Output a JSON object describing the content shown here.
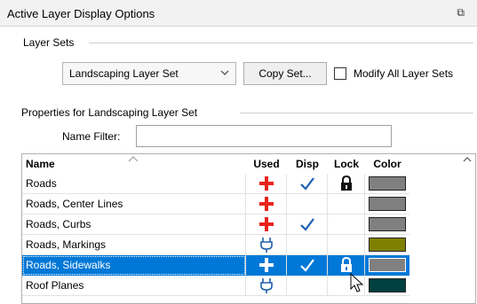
{
  "window": {
    "title": "Active Layer Display Options",
    "float_glyph": "⧉"
  },
  "layer_sets": {
    "group_label": "Layer Sets",
    "selected_set": "Landscaping Layer Set",
    "copy_button": "Copy Set...",
    "modify_all_label": "Modify All Layer Sets",
    "modify_all_checked": false
  },
  "properties": {
    "group_label": "Properties for Landscaping Layer Set",
    "name_filter_label": "Name Filter:",
    "name_filter_value": ""
  },
  "grid": {
    "columns": {
      "name": "Name",
      "used": "Used",
      "disp": "Disp",
      "lock": "Lock",
      "color": "Color"
    },
    "rows": [
      {
        "name": "Roads",
        "used": "cross",
        "disp": true,
        "lock": true,
        "color": "#808080",
        "selected": false
      },
      {
        "name": "Roads, Center Lines",
        "used": "cross",
        "disp": false,
        "lock": false,
        "color": "#808080",
        "selected": false
      },
      {
        "name": "Roads, Curbs",
        "used": "cross",
        "disp": true,
        "lock": false,
        "color": "#808080",
        "selected": false
      },
      {
        "name": "Roads, Markings",
        "used": "plug",
        "disp": false,
        "lock": false,
        "color": "#808000",
        "selected": false
      },
      {
        "name": "Roads, Sidewalks",
        "used": "cross",
        "disp": true,
        "lock": true,
        "color": "#808080",
        "selected": true
      },
      {
        "name": "Roof Planes",
        "used": "plug",
        "disp": false,
        "lock": false,
        "color": "#004040",
        "selected": false
      }
    ]
  },
  "colors": {
    "accent": "#0078d7",
    "used_red": "#e8231c",
    "check_blue": "#1a5fb4",
    "plug_blue": "#1f5fa8"
  },
  "icons": {
    "used": "plus-cross-icon",
    "used_alt": "plug-icon",
    "disp": "checkmark-icon",
    "lock": "padlock-icon",
    "sort": "sort-ascending-icon",
    "scroll": "scroll-up-icon",
    "dropdown": "chevron-down-icon"
  }
}
